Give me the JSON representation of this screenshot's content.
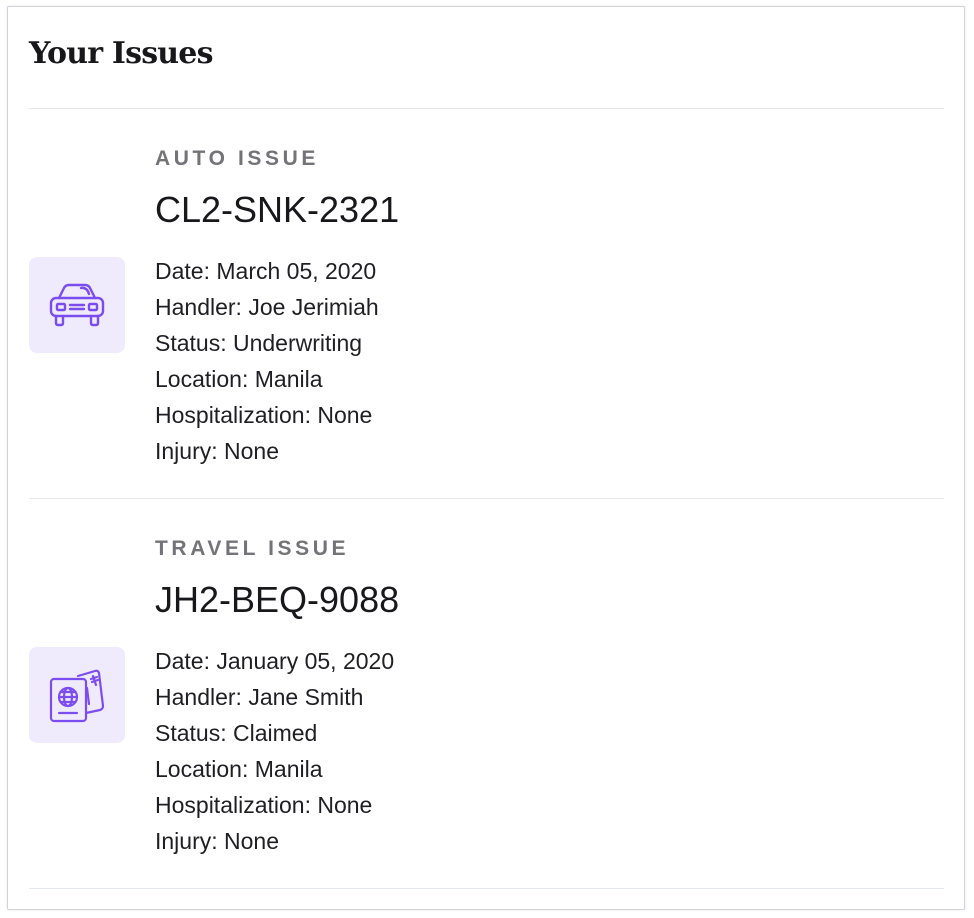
{
  "page": {
    "title": "Your Issues"
  },
  "colors": {
    "icon_stroke": "#7c4dee",
    "icon_background": "#efebfd",
    "divider": "#e4e7eb"
  },
  "issues": [
    {
      "type": "AUTO ISSUE",
      "id": "CL2-SNK-2321",
      "icon": "car-icon",
      "details": [
        "Date: March 05, 2020",
        "Handler: Joe Jerimiah",
        "Status: Underwriting",
        "Location: Manila",
        "Hospitalization: None",
        "Injury: None"
      ]
    },
    {
      "type": "TRAVEL ISSUE",
      "id": "JH2-BEQ-9088",
      "icon": "passport-ticket-icon",
      "details": [
        "Date: January 05, 2020",
        "Handler: Jane Smith",
        "Status: Claimed",
        "Location: Manila",
        "Hospitalization: None",
        "Injury: None"
      ]
    }
  ]
}
